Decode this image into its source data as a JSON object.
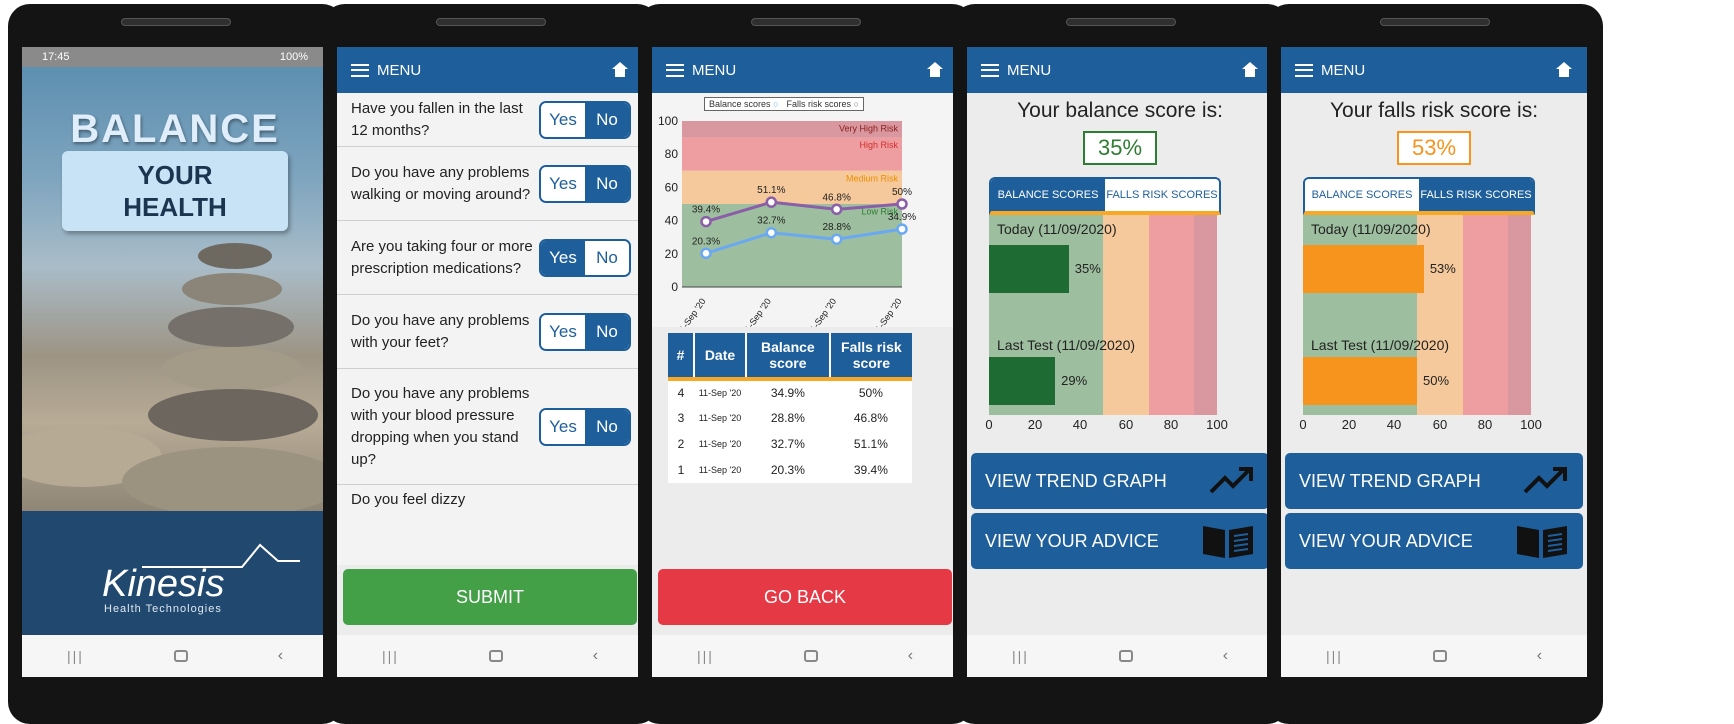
{
  "phone1": {
    "status_time": "17:45",
    "status_right": "100%",
    "title_big": "BALANCE",
    "title_line1": "YOUR",
    "title_line2": "HEALTH",
    "brand_name": "Kinesis",
    "brand_sub": "Health Technologies"
  },
  "header": {
    "menu_label": "MENU"
  },
  "questionnaire": {
    "questions": [
      {
        "text": "Have you fallen in the last 12 months?",
        "yes": "Yes",
        "no": "No",
        "selected": "No"
      },
      {
        "text": "Do you have any problems walking or moving around?",
        "yes": "Yes",
        "no": "No",
        "selected": "No"
      },
      {
        "text": "Are you taking four or more prescription medications?",
        "yes": "Yes",
        "no": "No",
        "selected": "Yes"
      },
      {
        "text": "Do you have any problems with your feet?",
        "yes": "Yes",
        "no": "No",
        "selected": "No"
      },
      {
        "text": "Do you have any problems with your blood pressure dropping when you stand up?",
        "yes": "Yes",
        "no": "No",
        "selected": "No"
      },
      {
        "text": "Do you feel dizzy"
      }
    ],
    "submit_label": "SUBMIT"
  },
  "trend": {
    "legend_balance": "Balance scores",
    "legend_falls": "Falls risk scores",
    "zones": [
      "Very High Risk",
      "High Risk",
      "Medium Risk",
      "Low Risk"
    ],
    "table_headers": [
      "#",
      "Date",
      "Balance score",
      "Falls risk score"
    ],
    "rows": [
      {
        "n": "4",
        "date": "11-Sep '20",
        "balance": "34.9%",
        "falls": "50%"
      },
      {
        "n": "3",
        "date": "11-Sep '20",
        "balance": "28.8%",
        "falls": "46.8%"
      },
      {
        "n": "2",
        "date": "11-Sep '20",
        "balance": "32.7%",
        "falls": "51.1%"
      },
      {
        "n": "1",
        "date": "11-Sep '20",
        "balance": "20.3%",
        "falls": "39.4%"
      }
    ],
    "go_back_label": "GO BACK"
  },
  "chart_data": {
    "type": "line",
    "x": [
      "11-Sep '20",
      "11-Sep '20",
      "11-Sep '20",
      "11-Sep '20"
    ],
    "series": [
      {
        "name": "Balance scores",
        "values": [
          20.3,
          32.7,
          28.8,
          34.9
        ],
        "color": "#6aa9f2"
      },
      {
        "name": "Falls risk scores",
        "values": [
          39.4,
          51.1,
          46.8,
          50
        ],
        "color": "#8b5ea8"
      }
    ],
    "ylim": [
      0,
      100
    ],
    "yticks": [
      0,
      20,
      40,
      60,
      80,
      100
    ],
    "point_labels": {
      "balance": [
        "20.3%",
        "32.7%",
        "28.8%",
        "34.9%"
      ],
      "falls": [
        "39.4%",
        "51.1%",
        "46.8%",
        "50%"
      ]
    },
    "legend": "top"
  },
  "balance_result": {
    "title": "Your balance score is:",
    "score": "35%",
    "score_color": "#2e7d32",
    "tab_balance": "BALANCE SCORES",
    "tab_falls": "FALLS RISK SCORES",
    "today_label": "Today (11/09/2020)",
    "today_value": 35,
    "today_text": "35%",
    "last_label": "Last Test (11/09/2020)",
    "last_value": 29,
    "last_text": "29%",
    "bar_color": "#1f6b34"
  },
  "falls_result": {
    "title": "Your falls risk score is:",
    "score": "53%",
    "score_color": "#f7941d",
    "tab_balance": "BALANCE SCORES",
    "tab_falls": "FALLS RISK SCORES",
    "today_label": "Today (11/09/2020)",
    "today_value": 53,
    "today_text": "53%",
    "last_label": "Last Test (11/09/2020)",
    "last_value": 50,
    "last_text": "50%",
    "bar_color": "#f7941d"
  },
  "axis_ticks": [
    "0",
    "20",
    "40",
    "60",
    "80",
    "100"
  ],
  "actions": {
    "trend_label": "VIEW TREND GRAPH",
    "advice_label": "VIEW YOUR ADVICE"
  },
  "colors": {
    "primary": "#1e5f9b",
    "accent": "#f7a825",
    "submit": "#43a047",
    "go_back": "#e53945",
    "zone_low": "#9ebf9f",
    "zone_medium": "#f5c99b",
    "zone_high": "#ee9ea0",
    "zone_very_high": "#d9989f"
  }
}
